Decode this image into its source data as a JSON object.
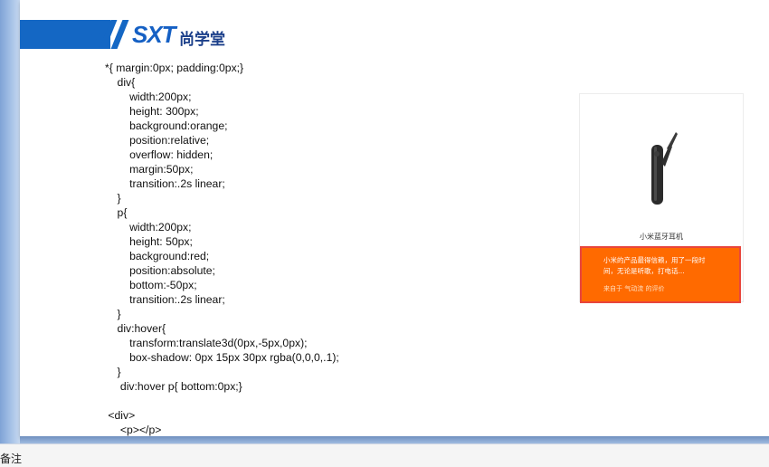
{
  "slide": {
    "logo_text": "SXT",
    "logo_cn": "尚学堂",
    "code": "*{ margin:0px; padding:0px;}\n    div{\n        width:200px;\n        height: 300px;\n        background:orange;\n        position:relative;\n        overflow: hidden;\n        margin:50px;\n        transition:.2s linear;\n    }\n    p{\n        width:200px;\n        height: 50px;\n        background:red;\n        position:absolute;\n        bottom:-50px;\n        transition:.2s linear;\n    }\n    div:hover{\n        transform:translate3d(0px,-5px,0px);\n        box-shadow: 0px 15px 30px rgba(0,0,0,.1);\n    }\n     div:hover p{ bottom:0px;}\n\n <div>\n     <p></p>\n </div>"
  },
  "demo": {
    "product_name": "小米蓝牙耳机",
    "review": "小米的产品最得信赖，用了一段时间，无论是听歌，打电话...",
    "source": "来自于 气动流 的评价"
  },
  "colors": {
    "brand_blue": "#1467c4",
    "panel_orange": "#ff6a00",
    "highlight_red": "#e8453c"
  },
  "status_bar": {
    "text": "备注"
  }
}
